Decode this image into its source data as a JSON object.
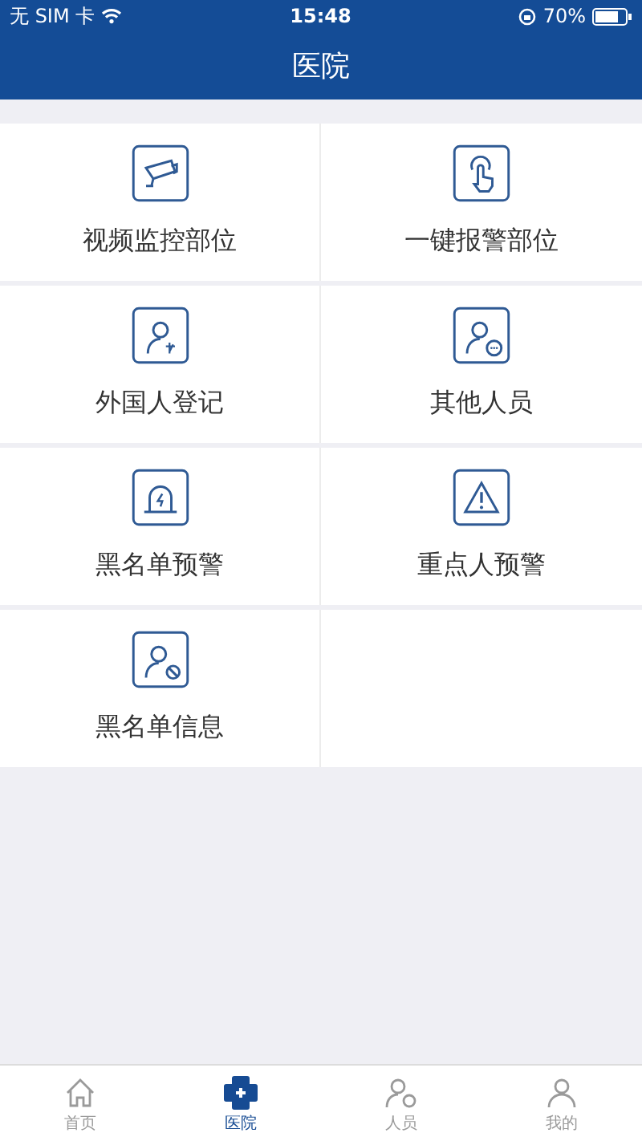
{
  "status_bar": {
    "carrier": "无 SIM 卡",
    "time": "15:48",
    "battery": "70%"
  },
  "header": {
    "title": "医院"
  },
  "grid": [
    {
      "label": "视频监控部位",
      "kind": "camera"
    },
    {
      "label": "一键报警部位",
      "kind": "touch"
    },
    {
      "label": "外国人登记",
      "kind": "foreigner"
    },
    {
      "label": "其他人员",
      "kind": "other"
    },
    {
      "label": "黑名单预警",
      "kind": "siren"
    },
    {
      "label": "重点人预警",
      "kind": "warning"
    },
    {
      "label": "黑名单信息",
      "kind": "blocked"
    }
  ],
  "tab_bar": [
    {
      "label": "首页",
      "kind": "home",
      "selected": false
    },
    {
      "label": "医院",
      "kind": "hospital",
      "selected": true
    },
    {
      "label": "人员",
      "kind": "people",
      "selected": false
    },
    {
      "label": "我的",
      "kind": "me",
      "selected": false
    }
  ]
}
